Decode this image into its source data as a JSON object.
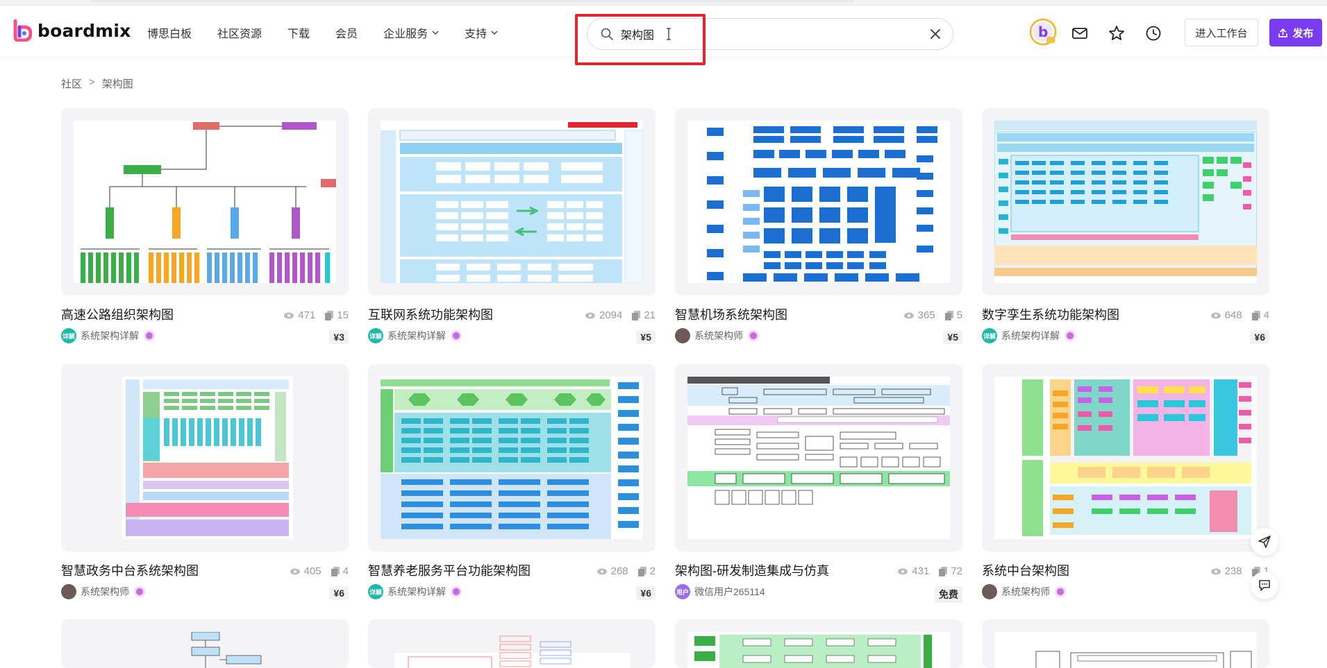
{
  "brand": {
    "name": "boardmix",
    "accent": "#7a3cf0"
  },
  "nav": [
    {
      "label": "博思白板",
      "dropdown": false
    },
    {
      "label": "社区资源",
      "dropdown": false
    },
    {
      "label": "下载",
      "dropdown": false
    },
    {
      "label": "会员",
      "dropdown": false
    },
    {
      "label": "企业服务",
      "dropdown": true
    },
    {
      "label": "支持",
      "dropdown": true
    }
  ],
  "search": {
    "value": "架构图",
    "icon": "search-icon"
  },
  "header_actions": {
    "enter_workspace": "进入工作台",
    "publish": "发布"
  },
  "breadcrumb": {
    "root": "社区",
    "separator": ">",
    "current": "架构图"
  },
  "cards": [
    {
      "title": "高速公路组织架构图",
      "views": "471",
      "copies": "15",
      "author": "系统架构详解",
      "avatar_text": "详解",
      "avatar_color": "#1fb8a8",
      "price": "¥3",
      "thumb": "org"
    },
    {
      "title": "互联网系统功能架构图",
      "views": "2094",
      "copies": "21",
      "author": "系统架构详解",
      "avatar_text": "详解",
      "avatar_color": "#1fb8a8",
      "price": "¥5",
      "thumb": "func"
    },
    {
      "title": "智慧机场系统架构图",
      "views": "365",
      "copies": "5",
      "author": "系统架构师",
      "avatar_text": "",
      "avatar_color": "#6b5a57",
      "price": "¥5",
      "thumb": "blue"
    },
    {
      "title": "数字孪生系统功能架构图",
      "views": "648",
      "copies": "4",
      "author": "系统架构详解",
      "avatar_text": "详解",
      "avatar_color": "#1fb8a8",
      "price": "¥6",
      "thumb": "twin"
    },
    {
      "title": "智慧政务中台系统架构图",
      "views": "405",
      "copies": "4",
      "author": "系统架构师",
      "avatar_text": "",
      "avatar_color": "#6b5a57",
      "price": "¥6",
      "thumb": "gov"
    },
    {
      "title": "智慧养老服务平台功能架构图",
      "views": "268",
      "copies": "2",
      "author": "系统架构详解",
      "avatar_text": "详解",
      "avatar_color": "#1fb8a8",
      "price": "¥6",
      "thumb": "elder"
    },
    {
      "title": "架构图-研发制造集成与仿真",
      "views": "431",
      "copies": "72",
      "author": "微信用户265114",
      "avatar_text": "用户",
      "avatar_color": "#9b6cf0",
      "price": "免费",
      "thumb": "rd"
    },
    {
      "title": "系统中台架构图",
      "views": "238",
      "copies": "1",
      "author": "系统架构师",
      "avatar_text": "",
      "avatar_color": "#6b5a57",
      "price": "",
      "thumb": "mid"
    }
  ],
  "colors": {
    "highlight": "#e0262c",
    "blue": "#1a6fd1",
    "green": "#3aae49"
  }
}
